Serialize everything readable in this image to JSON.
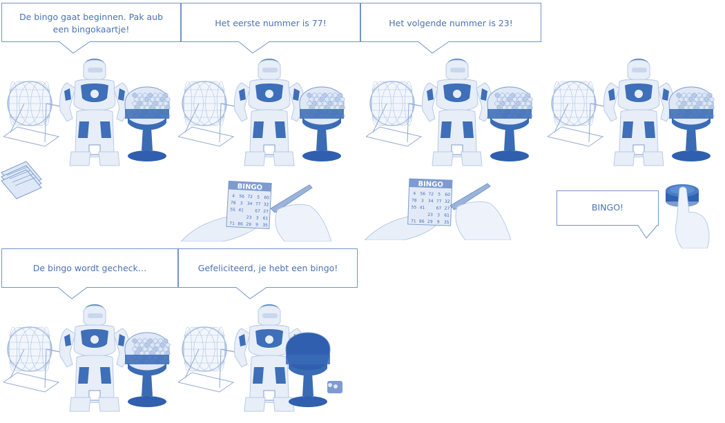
{
  "colors": {
    "bubble_border": "#6f93c9",
    "text": "#4a72b2",
    "robot_light": "#e7eef8",
    "robot_dark": "#3e6fb8",
    "globe_blue": "#3a6bb5",
    "card_blue": "#7d9bd0"
  },
  "bubbles": [
    {
      "id": "b1",
      "text": "De bingo gaat beginnen. Pak aub een bingokaartje!"
    },
    {
      "id": "b2",
      "text": "Het eerste nummer is 77!"
    },
    {
      "id": "b3",
      "text": "Het volgende nummer is 23!"
    },
    {
      "id": "b4",
      "text": "BINGO!"
    },
    {
      "id": "b5",
      "text": "De bingo wordt gecheck…"
    },
    {
      "id": "b6",
      "text": "Gefeliciteerd, je hebt een bingo!"
    }
  ],
  "bingo_card": {
    "header": "BINGO",
    "rows": [
      [
        "4",
        "56",
        "72",
        "5",
        "60"
      ],
      [
        "78",
        "3",
        "34",
        "77",
        "32"
      ],
      [
        "55",
        "41",
        "",
        "67",
        "27"
      ],
      [
        "",
        "",
        "23",
        "3",
        "61"
      ],
      [
        "71",
        "86",
        "29",
        "9",
        "35"
      ]
    ]
  },
  "icons": [
    "bingo-cage-icon",
    "nao-robot-icon",
    "ball-dispenser-globe-icon",
    "bingo-cards-stack-icon",
    "hand-marking-card-icon",
    "hand-pressing-button-icon"
  ]
}
